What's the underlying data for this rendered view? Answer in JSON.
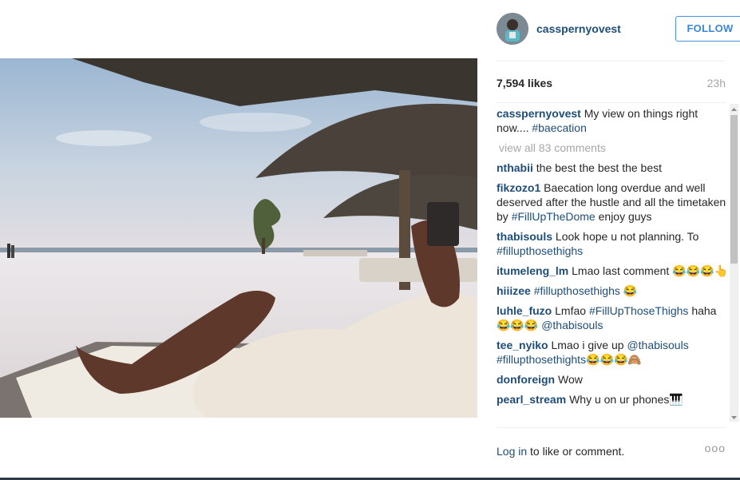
{
  "post": {
    "username": "casspernyovest",
    "follow_label": "FOLLOW",
    "likes": "7,594 likes",
    "time": "23h"
  },
  "caption": {
    "author": "casspernyovest",
    "text": "My view on things right now.... ",
    "hashtag": "#baecation"
  },
  "view_all": "view all 83 comments",
  "comments": [
    {
      "author": "nthabii",
      "text": "the best the best the best"
    },
    {
      "author": "fikzozo1",
      "text": "Baecation long overdue and well deserved after the hustle and all the timetaken by ",
      "tag": "#FillUpTheDome",
      "after": " enjoy guys"
    },
    {
      "author": "thabisouls",
      "text": "Look hope u not planning. To ",
      "tag": "#fillupthosethighs"
    },
    {
      "author": "itumeleng_lm",
      "text": "Lmao last comment 😂😂😂👆"
    },
    {
      "author": "hiiizee",
      "text": "",
      "tag": "#fillupthosethighs",
      "after": " 😂"
    },
    {
      "author": "luhle_fuzo",
      "text": "Lmfao ",
      "tag": "#FillUpThoseThighs",
      "after": " haha😂😂😂 ",
      "tag2": "@thabisouls"
    },
    {
      "author": "tee_nyiko",
      "text": "Lmao i give up ",
      "tag": "@thabisouls",
      "after": " ",
      "tag2": "#fillupthosethights",
      "after2": "😂😂😂🙈"
    },
    {
      "author": "donforeign",
      "text": "Wow"
    },
    {
      "author": "pearl_stream",
      "text": "Why u on ur phones🎹"
    }
  ],
  "footer": {
    "login": "Log in",
    "rest": " to like or comment.",
    "more": "ooo"
  },
  "icons": {
    "avatar": "avatar-image",
    "more": "more-options-icon"
  }
}
